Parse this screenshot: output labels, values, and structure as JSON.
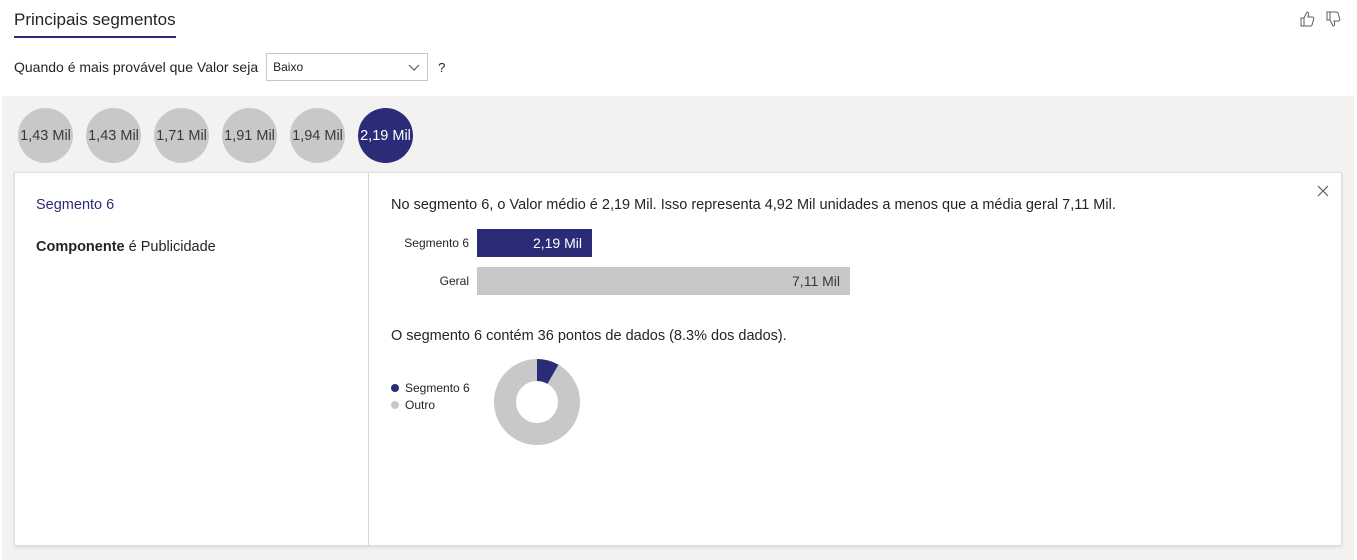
{
  "header": {
    "title": "Principais segmentos"
  },
  "question": {
    "label": "Quando é mais provável que Valor seja",
    "selected": "Baixo",
    "help": "?"
  },
  "bubbles": [
    "1,43 Mil",
    "1,43 Mil",
    "1,71 Mil",
    "1,91 Mil",
    "1,94 Mil",
    "2,19 Mil"
  ],
  "selected_index": 5,
  "segment": {
    "name": "Segmento 6",
    "condition_field": "Componente",
    "condition_text": " é Publicidade",
    "summary": "No segmento 6, o Valor médio é 2,19 Mil. Isso representa 4,92 Mil unidades a menos que a média geral 7,11 Mil.",
    "bars": [
      {
        "label": "Segmento 6",
        "value_label": "2,19 Mil",
        "value": 2.19
      },
      {
        "label": "Geral",
        "value_label": "7,11 Mil",
        "value": 7.11
      }
    ],
    "points_text": "O segmento 6 contém 36 pontos de dados (8.3% dos dados).",
    "share": 0.083,
    "legend": [
      {
        "name": "Segmento 6",
        "color": "#2b2c78"
      },
      {
        "name": "Outro",
        "color": "#c8c8c8"
      }
    ]
  },
  "colors": {
    "accent": "#2b2c78",
    "neutral": "#c8c8c8"
  },
  "icons": {
    "like": "thumbs-up-icon",
    "dislike": "thumbs-down-icon",
    "close": "close-icon",
    "dropdown": "chevron-down-icon"
  }
}
